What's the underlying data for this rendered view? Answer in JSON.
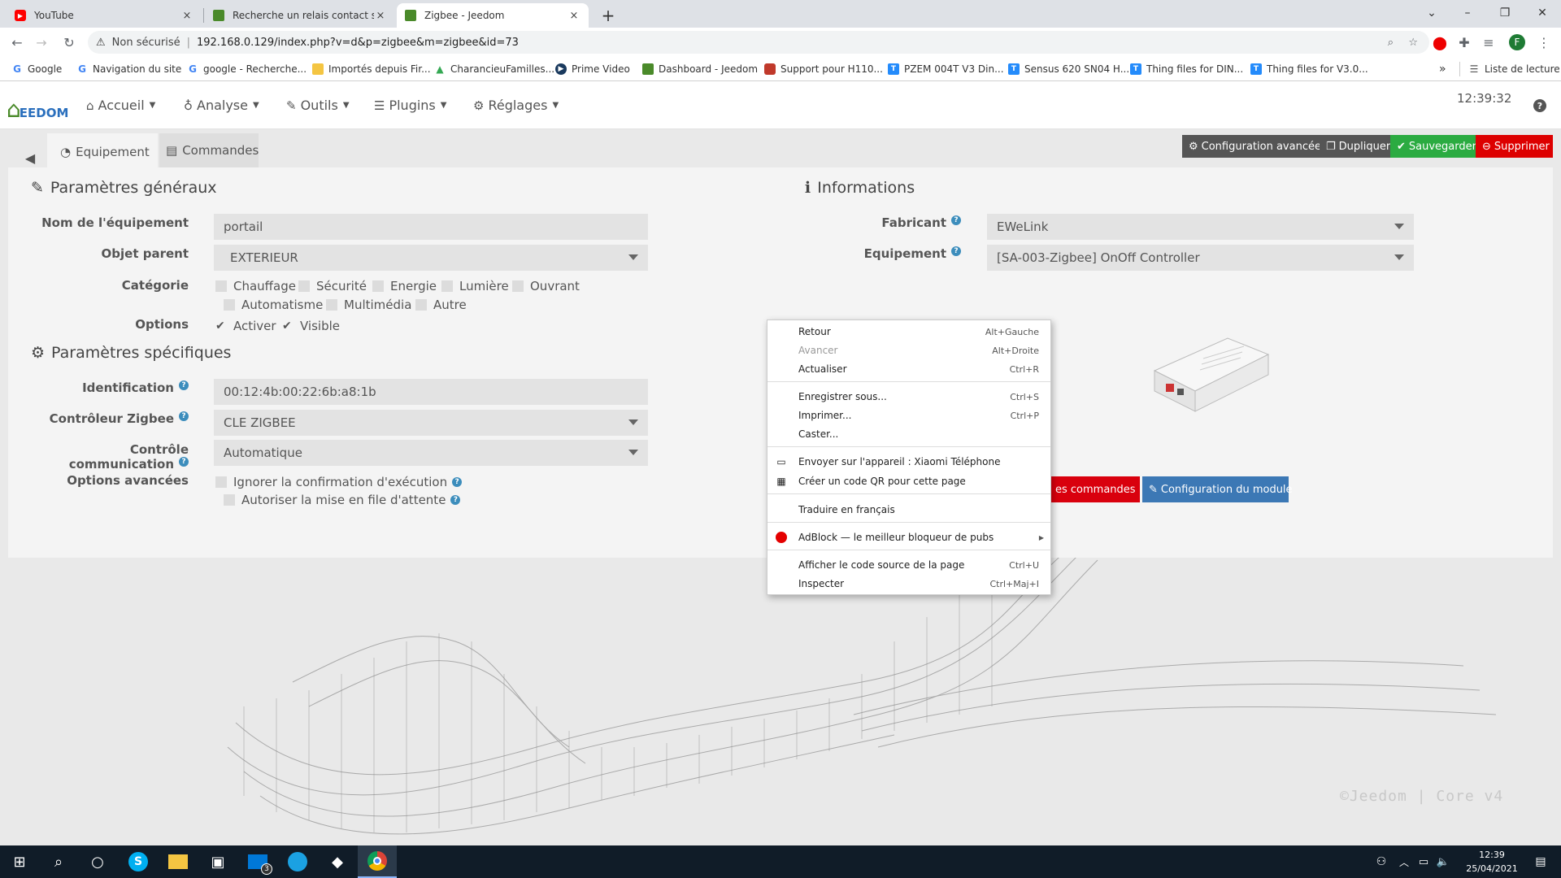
{
  "browser": {
    "tabs": [
      {
        "title": "YouTube",
        "close": "×"
      },
      {
        "title": "Recherche un relais contact sec e",
        "close": "×"
      },
      {
        "title": "Zigbee - Jeedom",
        "close": "×"
      }
    ],
    "new_tab": "+",
    "url_security": "Non sécurisé",
    "url_separator": "|",
    "url": "192.168.0.129/index.php?v=d&p=zigbee&m=zigbee&id=73",
    "profile_initial": "F",
    "bookmarks": [
      "Google",
      "Navigation du site",
      "google - Recherche...",
      "Importés depuis Fir...",
      "CharancieuFamilles...",
      "Prime Video",
      "Dashboard - Jeedom",
      "Support pour H110...",
      "PZEM 004T V3 Din...",
      "Sensus 620 SN04 H...",
      "Thing files for DIN...",
      "Thing files for V3.0..."
    ],
    "bookmarks_more": "»",
    "reading_list": "Liste de lecture"
  },
  "navbar": {
    "logo_text": "EEDOM",
    "menus": [
      "Accueil",
      "Analyse",
      "Outils",
      "Plugins",
      "Réglages"
    ],
    "clock": "12:39:32",
    "help": "?"
  },
  "tabs": {
    "equipement": "Equipement",
    "commandes": "Commandes"
  },
  "actions": {
    "advanced": "Configuration avancée",
    "duplicate": "Dupliquer",
    "save": "Sauvegarder",
    "delete": "Supprimer"
  },
  "general": {
    "title": "Paramètres généraux",
    "name_label": "Nom de l'équipement",
    "name_value": "portail",
    "parent_label": "Objet parent",
    "parent_value": "EXTERIEUR",
    "category_label": "Catégorie",
    "categories": [
      "Chauffage",
      "Sécurité",
      "Energie",
      "Lumière",
      "Ouvrant",
      "Automatisme",
      "Multimédia",
      "Autre"
    ],
    "options_label": "Options",
    "options": [
      "Activer",
      "Visible"
    ]
  },
  "specific": {
    "title": "Paramètres spécifiques",
    "id_label": "Identification",
    "id_value": "00:12:4b:00:22:6b:a8:1b",
    "controller_label": "Contrôleur Zigbee",
    "controller_value": "CLE ZIGBEE",
    "comm_label": "Contrôle communication",
    "comm_value": "Automatique",
    "advanced_label": "Options avancées",
    "advanced_options": [
      "Ignorer la confirmation d'exécution",
      "Autoriser la mise en file d'attente"
    ]
  },
  "info": {
    "title": "Informations",
    "maker_label": "Fabricant",
    "maker_value": "EWeLink",
    "equip_label": "Equipement",
    "equip_value": "[SA-003-Zigbee] OnOff Controller",
    "btn_commands": "es commandes",
    "btn_module": "Configuration du module"
  },
  "context_menu": [
    {
      "label": "Retour",
      "shortcut": "Alt+Gauche"
    },
    {
      "label": "Avancer",
      "shortcut": "Alt+Droite"
    },
    {
      "label": "Actualiser",
      "shortcut": "Ctrl+R"
    },
    {
      "label": "Enregistrer sous...",
      "shortcut": "Ctrl+S"
    },
    {
      "label": "Imprimer...",
      "shortcut": "Ctrl+P"
    },
    {
      "label": "Caster...",
      "shortcut": ""
    },
    {
      "label": "Envoyer sur l'appareil : Xiaomi Téléphone",
      "shortcut": ""
    },
    {
      "label": "Créer un code QR pour cette page",
      "shortcut": ""
    },
    {
      "label": "Traduire en français",
      "shortcut": ""
    },
    {
      "label": "AdBlock — le meilleur bloqueur de pubs",
      "shortcut": ""
    },
    {
      "label": "Afficher le code source de la page",
      "shortcut": "Ctrl+U"
    },
    {
      "label": "Inspecter",
      "shortcut": "Ctrl+Maj+I"
    }
  ],
  "footer": "©Jeedom | Core v4",
  "taskbar": {
    "time": "12:39",
    "date": "25/04/2021",
    "mail_badge": "3"
  }
}
